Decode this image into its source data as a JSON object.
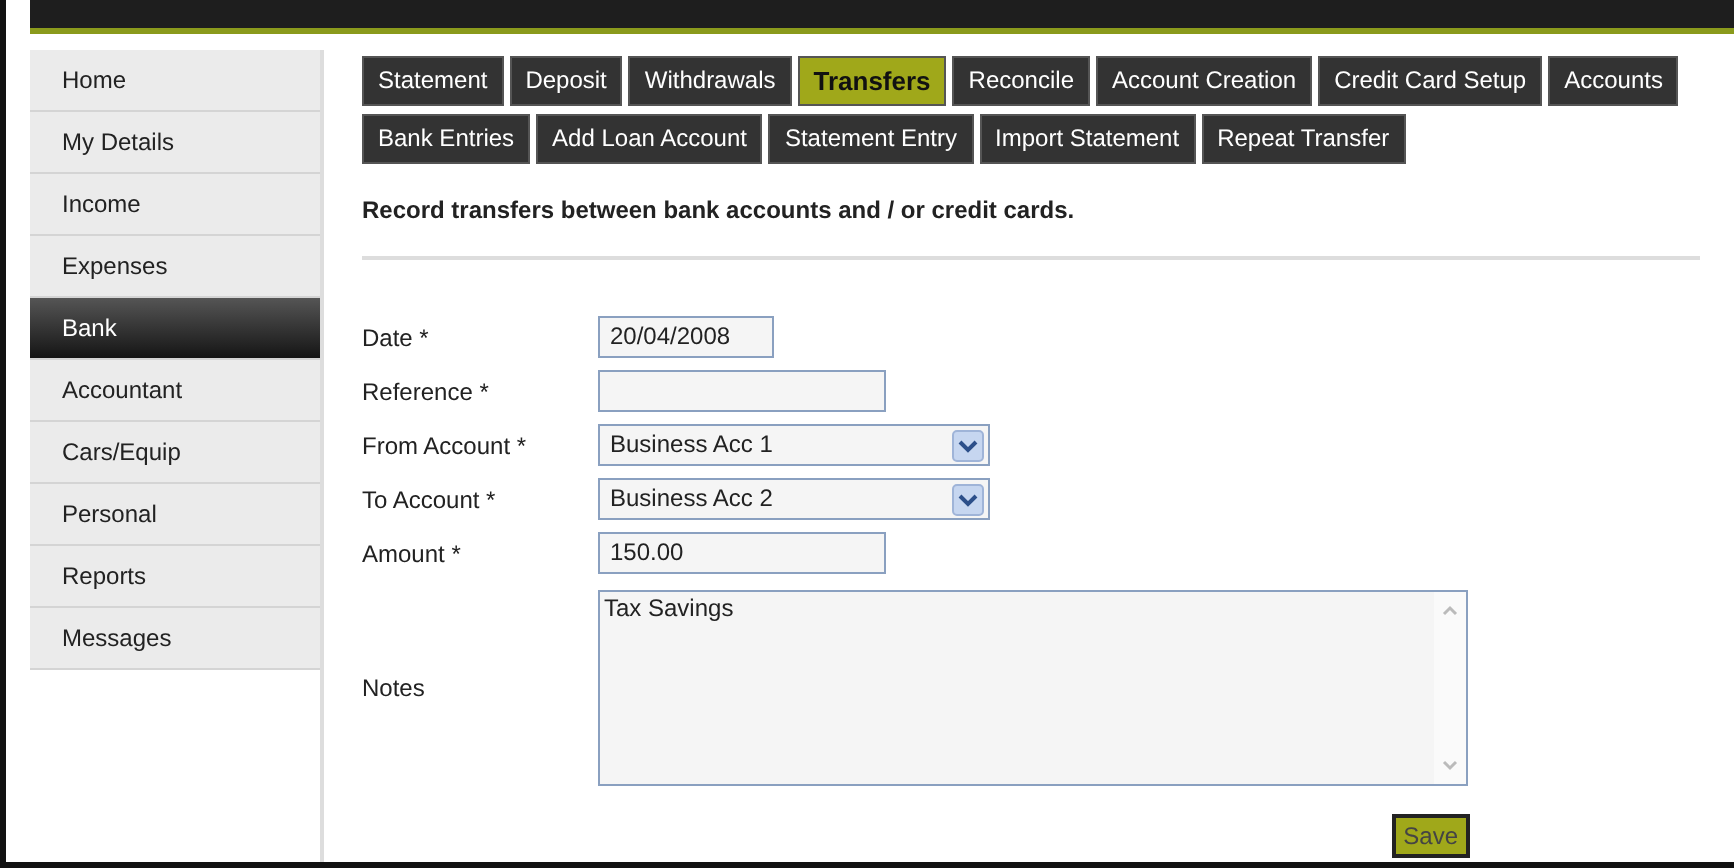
{
  "sidebar": {
    "items": [
      {
        "label": "Home",
        "selected": false
      },
      {
        "label": "My Details",
        "selected": false
      },
      {
        "label": "Income",
        "selected": false
      },
      {
        "label": "Expenses",
        "selected": false
      },
      {
        "label": "Bank",
        "selected": true
      },
      {
        "label": "Accountant",
        "selected": false
      },
      {
        "label": "Cars/Equip",
        "selected": false
      },
      {
        "label": "Personal",
        "selected": false
      },
      {
        "label": "Reports",
        "selected": false
      },
      {
        "label": "Messages",
        "selected": false
      }
    ]
  },
  "tabs": [
    [
      {
        "label": "Statement",
        "selected": false
      },
      {
        "label": "Deposit",
        "selected": false
      },
      {
        "label": "Withdrawals",
        "selected": false
      },
      {
        "label": "Transfers",
        "selected": true
      },
      {
        "label": "Reconcile",
        "selected": false
      },
      {
        "label": "Account Creation",
        "selected": false
      },
      {
        "label": "Credit Card Setup",
        "selected": false
      },
      {
        "label": "Accounts",
        "selected": false
      }
    ],
    [
      {
        "label": "Bank Entries",
        "selected": false
      },
      {
        "label": "Add Loan Account",
        "selected": false
      },
      {
        "label": "Statement Entry",
        "selected": false
      },
      {
        "label": "Import Statement",
        "selected": false
      },
      {
        "label": "Repeat Transfer",
        "selected": false
      }
    ]
  ],
  "heading": "Record transfers between bank accounts and / or credit cards.",
  "form": {
    "fields": [
      {
        "kind": "short",
        "label": "Date *",
        "value": "20/04/2008"
      },
      {
        "kind": "text",
        "label": "Reference *"
      },
      {
        "kind": "select",
        "label": "From Account *",
        "value": "Business Acc 1"
      },
      {
        "kind": "select",
        "label": "To Account *",
        "value": "Business Acc 2"
      },
      {
        "kind": "text",
        "label": "Amount *",
        "value": "150.00"
      },
      {
        "kind": "textarea",
        "label": "Notes",
        "value": "Tax Savings"
      }
    ],
    "save_button": "Save"
  }
}
